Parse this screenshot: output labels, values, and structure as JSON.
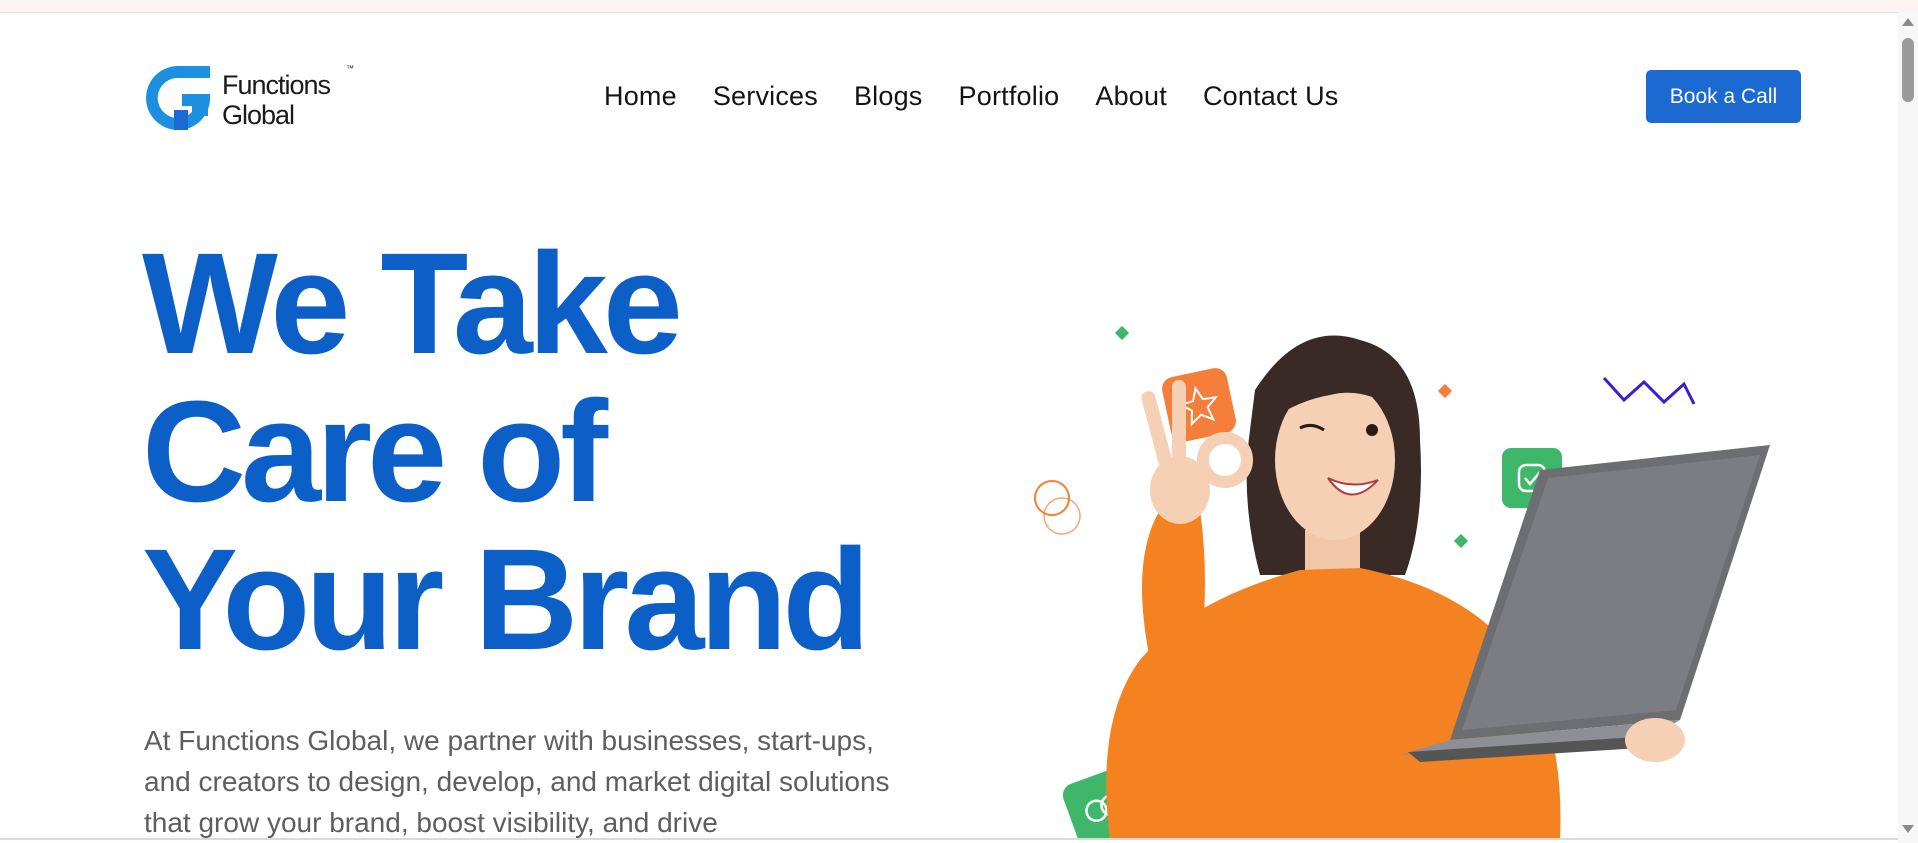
{
  "brand": {
    "name_line1": "Functions",
    "name_line2": "Global",
    "trademark": "™",
    "primary_color": "#1c6ad1",
    "heading_color": "#0d5fc8"
  },
  "nav": {
    "items": [
      {
        "label": "Home"
      },
      {
        "label": "Services"
      },
      {
        "label": "Blogs"
      },
      {
        "label": "Portfolio"
      },
      {
        "label": "About"
      },
      {
        "label": "Contact Us"
      }
    ],
    "cta_label": "Book a Call"
  },
  "hero": {
    "title_line1": "We Take",
    "title_line2": "Care of",
    "title_line3": "Your Brand",
    "description": "At Functions Global, we partner with businesses, start-ups, and creators to design, develop, and market digital solutions that grow your brand, boost visibility, and drive"
  },
  "illustration": {
    "icons": [
      "star-badge-icon",
      "check-badge-icon",
      "link-badge-icon",
      "zigzag-icon",
      "double-circle-icon"
    ],
    "sweater_color": "#f58220",
    "accent_green": "#3fb76a",
    "accent_orange": "#f47e3a"
  }
}
